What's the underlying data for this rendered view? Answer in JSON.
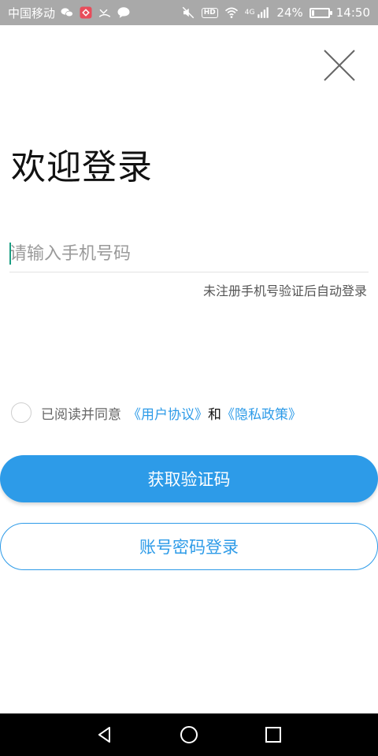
{
  "status_bar": {
    "carrier": "中国移动",
    "battery_percent": "24%",
    "battery_level": 0.24,
    "time": "14:50",
    "hd_label": "HD",
    "network_label": "4G"
  },
  "page": {
    "title": "欢迎登录"
  },
  "phone_input": {
    "placeholder": "请输入手机号码"
  },
  "hint": "未注册手机号验证后自动登录",
  "agreement": {
    "prefix": "已阅读并同意",
    "user_agreement": "《用户协议》",
    "and": "和",
    "privacy_policy": "《隐私政策》"
  },
  "buttons": {
    "get_code": "获取验证码",
    "password_login": "账号密码登录"
  },
  "colors": {
    "accent": "#2d9be8",
    "status_bar": "#a9a9a9"
  }
}
